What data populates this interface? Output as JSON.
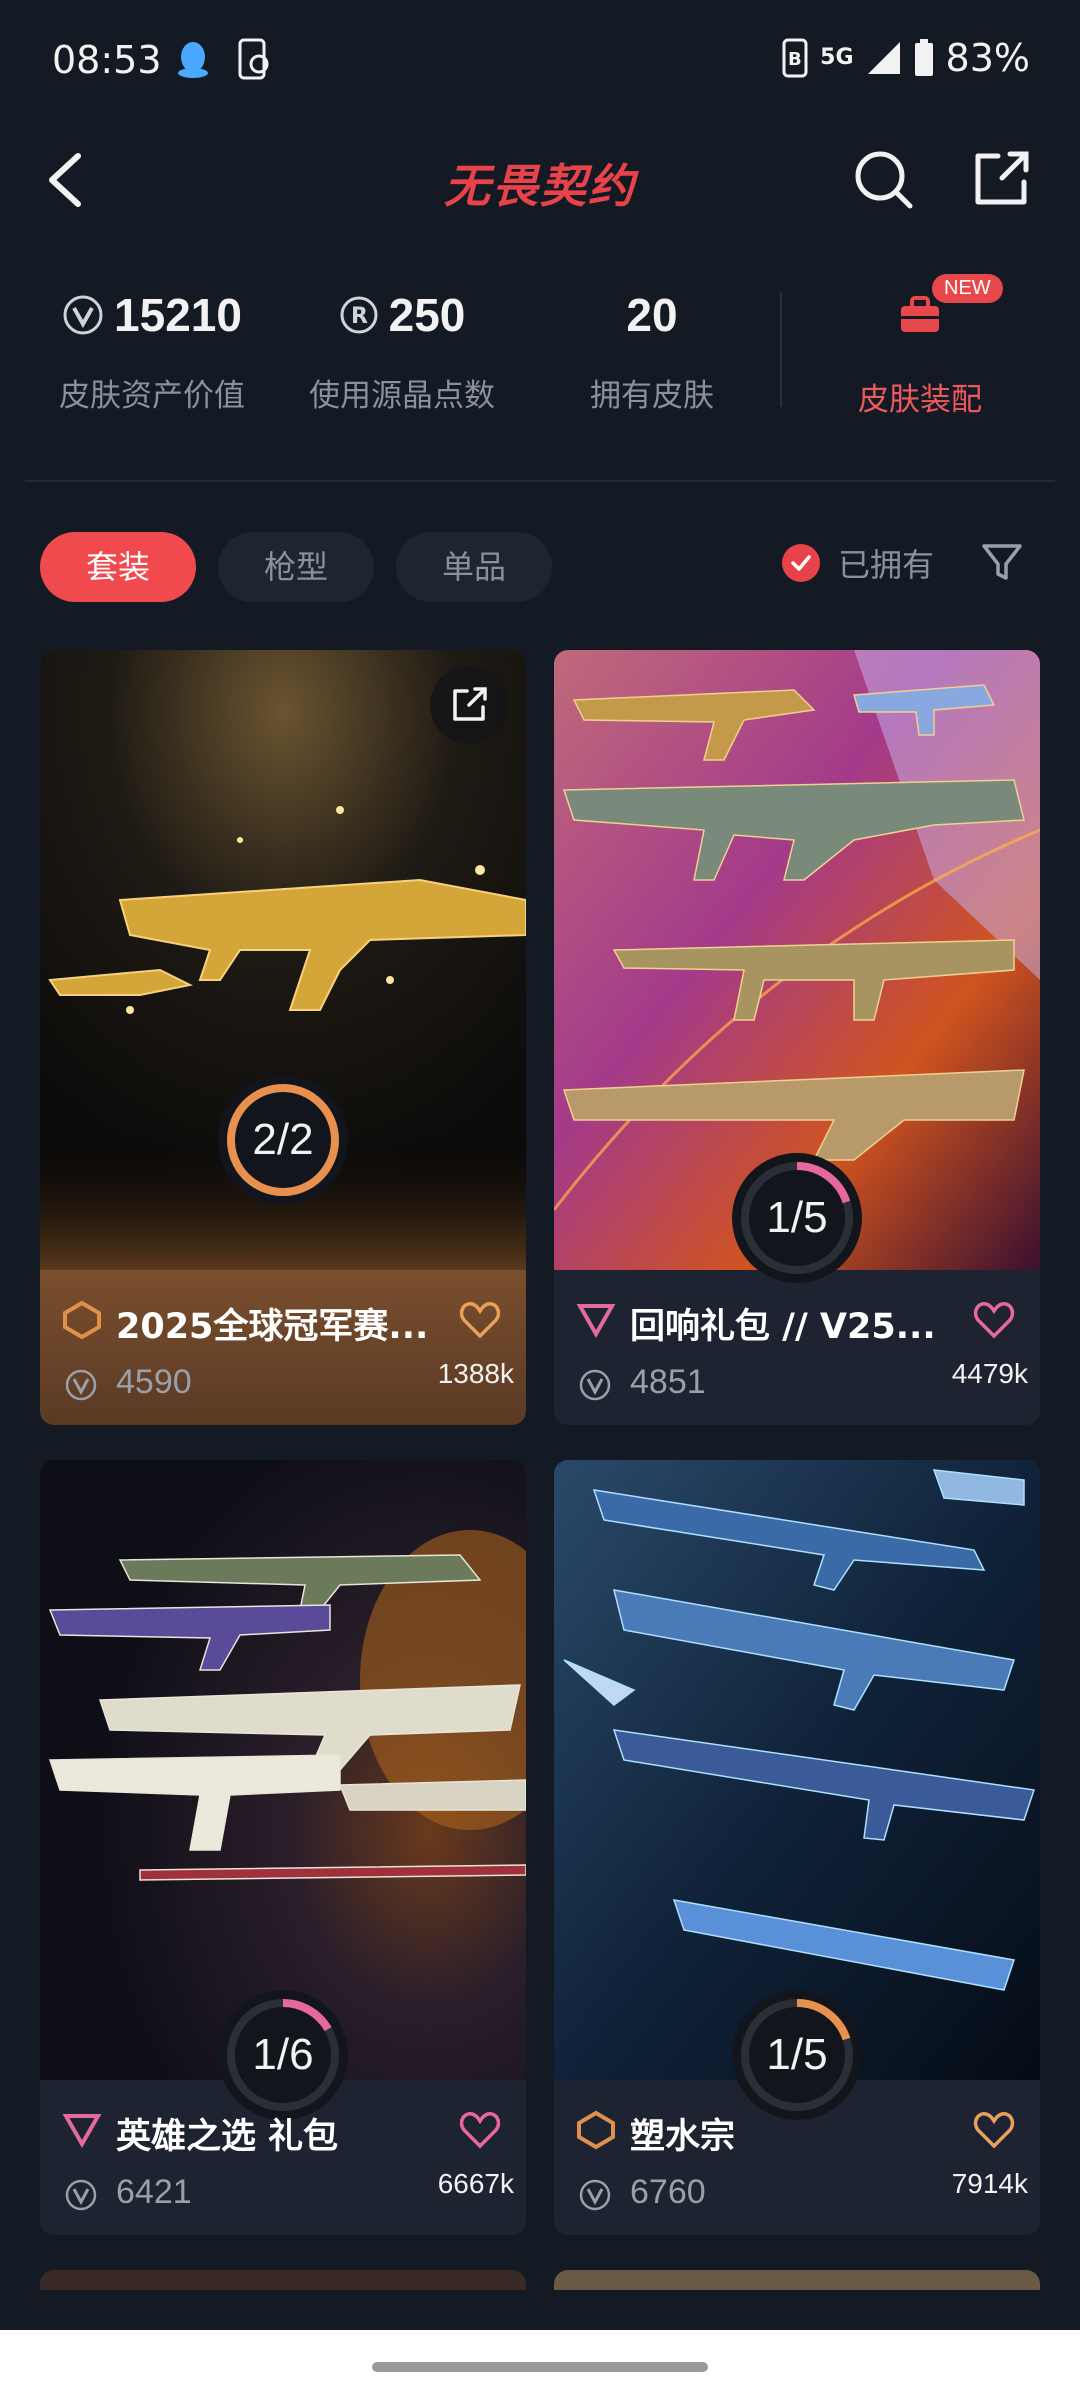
{
  "status_bar": {
    "time": "08:53",
    "network": "5G",
    "battery": "83%"
  },
  "header": {
    "title": "无畏契约"
  },
  "stats": [
    {
      "value": "15210",
      "label": "皮肤资产价值",
      "icon": "vp-coin-icon"
    },
    {
      "value": "250",
      "label": "使用源晶点数",
      "icon": "radianite-icon"
    },
    {
      "value": "20",
      "label": "拥有皮肤"
    }
  ],
  "equip": {
    "label": "皮肤装配",
    "badge": "NEW"
  },
  "tabs": [
    {
      "label": "套装",
      "active": true
    },
    {
      "label": "枪型",
      "active": false
    },
    {
      "label": "单品",
      "active": false
    }
  ],
  "owned_filter": {
    "label": "已拥有",
    "checked": true
  },
  "cards": [
    {
      "name": "2025全球冠军赛...",
      "price": "4590",
      "likes": "1388k",
      "progress": "2/2",
      "progress_fraction": 1.0,
      "tier": "exclusive",
      "tier_color": "#e0904a",
      "heart_color": "#e8a05a",
      "ring_color": "#e8914e"
    },
    {
      "name": "回响礼包 // V25...",
      "price": "4851",
      "likes": "4479k",
      "progress": "1/5",
      "progress_fraction": 0.2,
      "tier": "ultra",
      "tier_color": "#e26aa0",
      "heart_color": "#e8689e",
      "ring_color": "#e8689e"
    },
    {
      "name": "英雄之选 礼包",
      "price": "6421",
      "likes": "6667k",
      "progress": "1/6",
      "progress_fraction": 0.1667,
      "tier": "ultra",
      "tier_color": "#e26aa0",
      "heart_color": "#e8689e",
      "ring_color": "#e8689e"
    },
    {
      "name": "塑水宗",
      "price": "6760",
      "likes": "7914k",
      "progress": "1/5",
      "progress_fraction": 0.2,
      "tier": "exclusive",
      "tier_color": "#e0904a",
      "heart_color": "#e8a05a",
      "ring_color": "#e8914e"
    }
  ]
}
